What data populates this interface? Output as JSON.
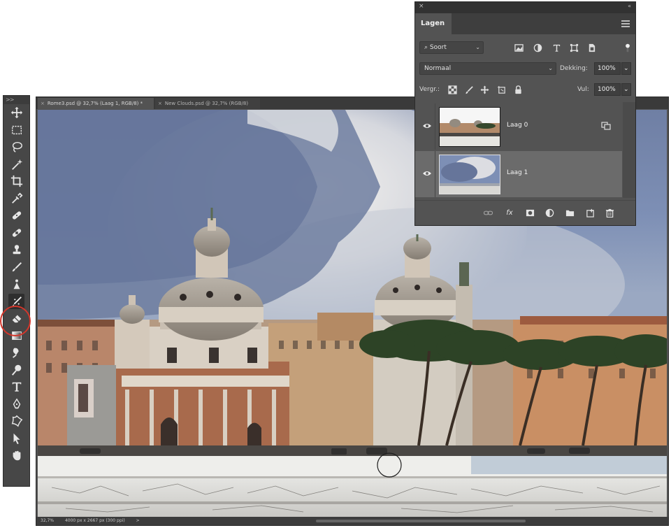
{
  "tools_panel": {
    "grip": ">>",
    "tools": [
      {
        "icon": "move-icon"
      },
      {
        "icon": "marquee-icon"
      },
      {
        "icon": "lasso-icon"
      },
      {
        "icon": "magic-wand-icon"
      },
      {
        "icon": "crop-icon"
      },
      {
        "icon": "eyedropper-icon"
      },
      {
        "icon": "healing-brush-icon"
      },
      {
        "icon": "bandage-icon"
      },
      {
        "icon": "stamp-icon"
      },
      {
        "icon": "brush-icon"
      },
      {
        "icon": "history-brush-icon"
      },
      {
        "icon": "mixer-brush-icon",
        "active": true
      },
      {
        "icon": "eraser-icon"
      },
      {
        "icon": "gradient-icon"
      },
      {
        "icon": "smudge-icon"
      },
      {
        "icon": "dodge-icon"
      },
      {
        "icon": "type-icon"
      },
      {
        "icon": "pen-icon"
      },
      {
        "icon": "custom-shape-icon"
      },
      {
        "icon": "selection-arrow-icon"
      },
      {
        "icon": "hand-icon"
      }
    ],
    "highlight_color": "#d3362b"
  },
  "document": {
    "tabs": [
      {
        "close": "×",
        "label": "Rome3.psd @ 32,7% (Laag 1, RGB/8) *"
      },
      {
        "close": "×",
        "label": "New Clouds.psd @ 32,7% (RGB/8)"
      }
    ],
    "status": {
      "zoom": "32,7%",
      "size": "4000 px x 2667 px (300 ppi)",
      "arrow": ">"
    }
  },
  "layers_panel": {
    "close": "×",
    "collapse": "«",
    "tab_label": "Lagen",
    "filter": {
      "label": "Soort",
      "arrow": "⌄"
    },
    "blend": {
      "label": "Normaal",
      "arrow": "⌄"
    },
    "opacity": {
      "label": "Dekking:",
      "value": "100%",
      "arrow": "⌄"
    },
    "lock": {
      "label": "Vergr.:"
    },
    "fill": {
      "label": "Vul:",
      "value": "100%",
      "arrow": "⌄"
    },
    "layers": [
      {
        "name": "Laag 0",
        "visible": true,
        "selected": false
      },
      {
        "name": "Laag 1",
        "visible": true,
        "selected": true
      }
    ],
    "bottom_icons": [
      "link-icon",
      "fx-icon",
      "mask-icon",
      "adjustment-icon",
      "folder-icon",
      "new-layer-icon",
      "trash-icon"
    ],
    "fx_label": "fx"
  },
  "colors": {
    "panel_bg": "#535353",
    "panel_dark": "#323232",
    "selected_layer": "#6b6b6b",
    "sky_blue": "#7d8fb5",
    "building_ochre": "#b8875e"
  }
}
